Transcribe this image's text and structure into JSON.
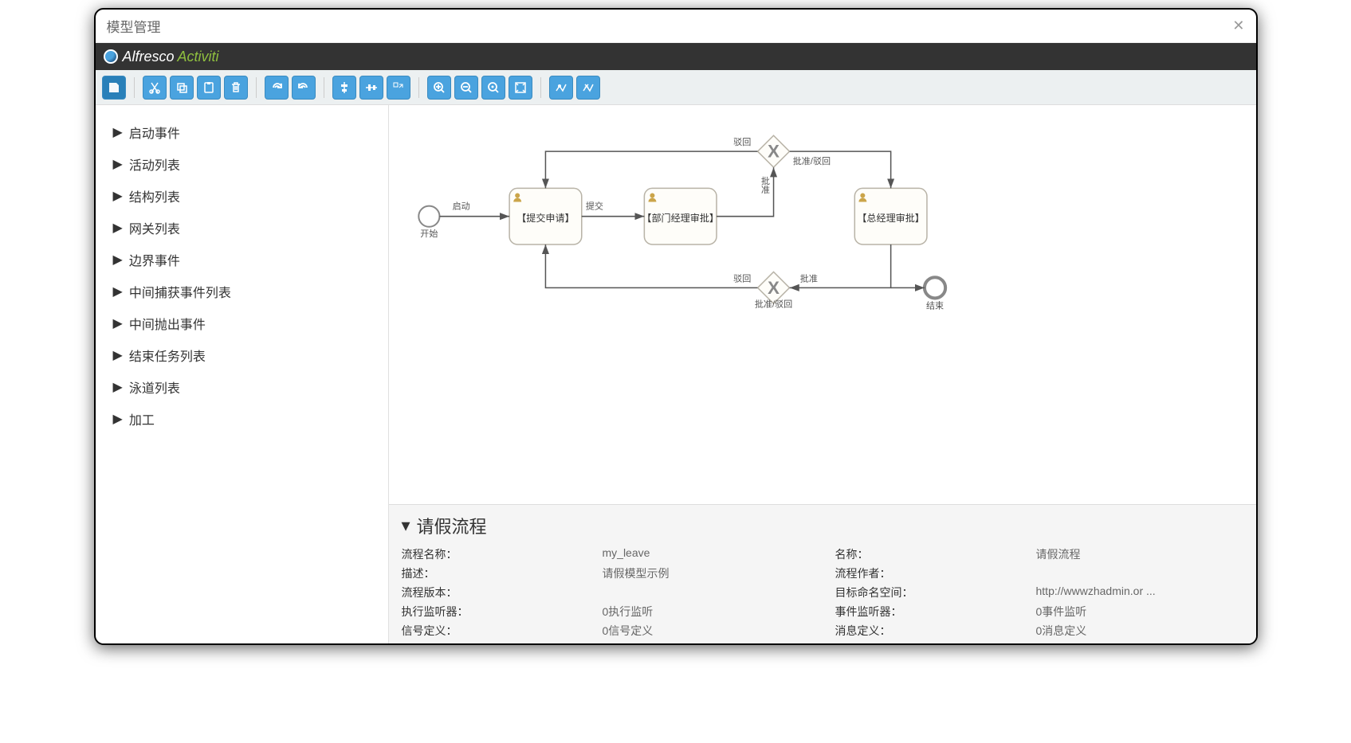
{
  "window": {
    "title": "模型管理"
  },
  "brand": {
    "alfresco": "Alfresco",
    "activiti": "Activiti"
  },
  "toolbar": {
    "save": "save",
    "cut": "cut",
    "copy": "copy",
    "paste": "paste",
    "delete": "delete",
    "redo": "redo",
    "undo": "undo",
    "alignV": "align-v",
    "alignH": "align-h",
    "sameSize": "same-size",
    "zoomIn": "zoom-in",
    "zoomOut": "zoom-out",
    "zoomActual": "zoom-actual",
    "zoomFit": "zoom-fit",
    "bendAdd": "bend-add",
    "bendRemove": "bend-remove"
  },
  "palette": {
    "items": [
      "启动事件",
      "活动列表",
      "结构列表",
      "网关列表",
      "边界事件",
      "中间捕获事件列表",
      "中间抛出事件",
      "结束任务列表",
      "泳道列表",
      "加工"
    ]
  },
  "diagram": {
    "startLabel": "开始",
    "endLabel": "结束",
    "task1": "【提交申请】",
    "task2": "【部门经理审批】",
    "task3": "【总经理审批】",
    "edgeStart": "启动",
    "edgeSubmit": "提交",
    "gw1Label": "批准/驳回",
    "gw1Reject": "驳回",
    "gw1Approve": "批准",
    "gw2Label": "批准/驳回",
    "gw2Reject": "驳回",
    "gw2Approve": "批准"
  },
  "properties": {
    "title": "请假流程",
    "rows": [
      {
        "l1": "流程名称：",
        "v1": "my_leave",
        "l2": "名称：",
        "v2": "请假流程"
      },
      {
        "l1": "描述：",
        "v1": "请假模型示例",
        "l2": "流程作者：",
        "v2": ""
      },
      {
        "l1": "流程版本：",
        "v1": "",
        "l2": "目标命名空间：",
        "v2": "http://wwwzhadmin.or ..."
      },
      {
        "l1": "执行监听器：",
        "v1": "0执行监听",
        "l2": "事件监听器：",
        "v2": "0事件监听"
      },
      {
        "l1": "信号定义：",
        "v1": "0信号定义",
        "l2": "消息定义：",
        "v2": "0消息定义"
      }
    ]
  }
}
